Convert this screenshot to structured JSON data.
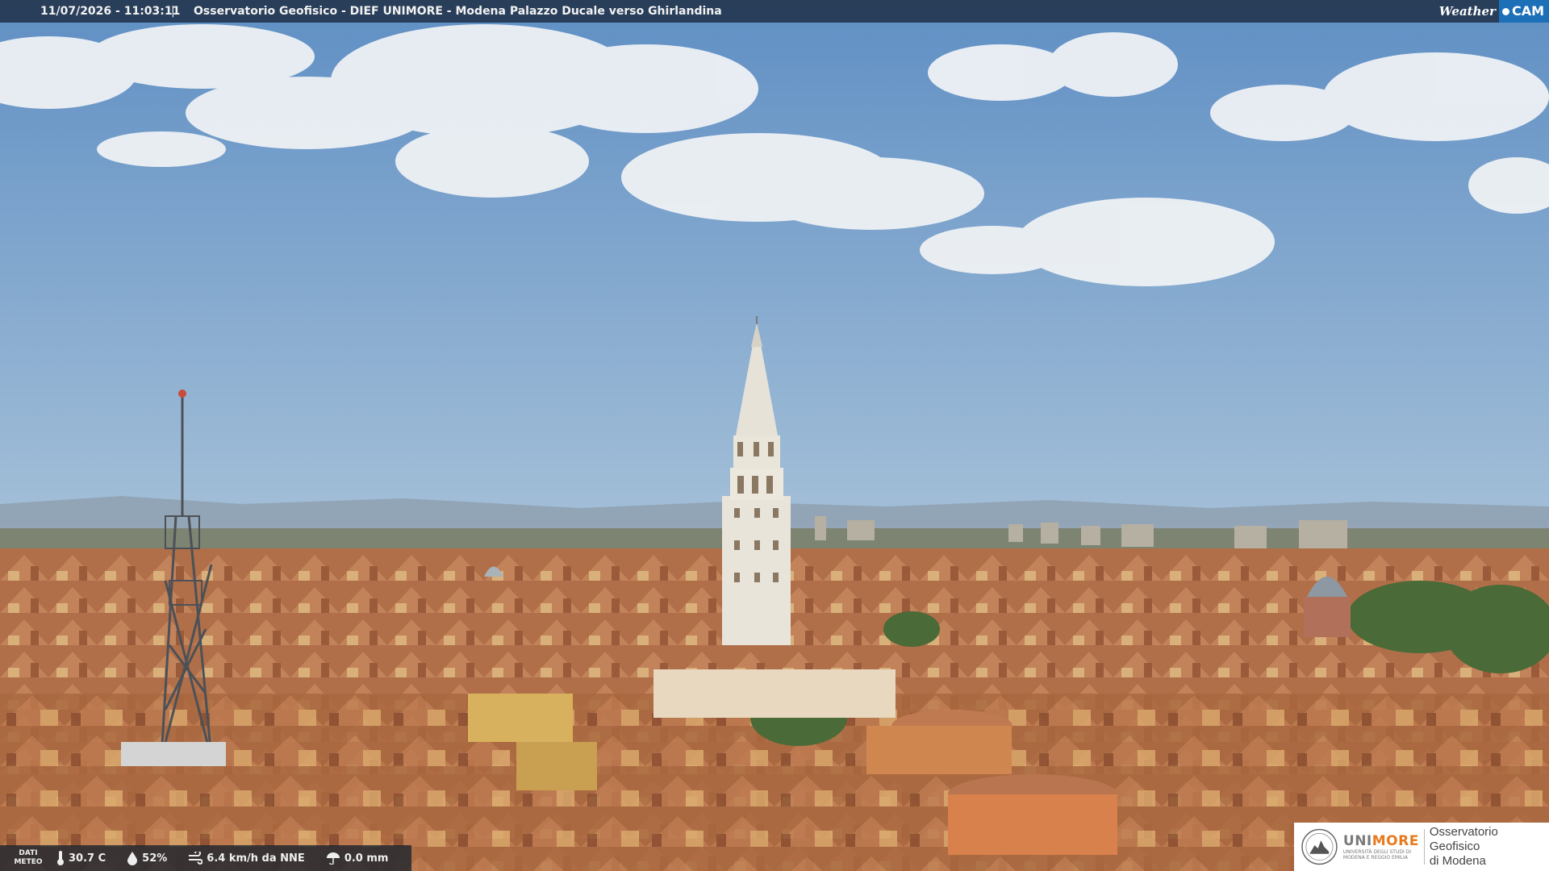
{
  "overlay": {
    "timestamp": "11/07/2026 - 11:03:11",
    "separator": "|",
    "title": "Osservatorio Geofisico - DIEF UNIMORE - Modena Palazzo Ducale verso Ghirlandina"
  },
  "brand": {
    "weather": "Weather",
    "cam": "CAM"
  },
  "meteo": {
    "label_line1": "DATI",
    "label_line2": "METEO",
    "temperature": "30.7 C",
    "humidity": "52%",
    "wind": "6.4 km/h da NNE",
    "rain": "0.0 mm"
  },
  "logo": {
    "uni_prefix": "UNI",
    "uni_suffix": "MORE",
    "uni_sub1": "UNIVERSITÀ DEGLI STUDI DI",
    "uni_sub2": "MODENA E REGGIO EMILIA",
    "obs_line1": "Osservatorio Geofisico",
    "obs_line2": "di Modena"
  },
  "colors": {
    "sky_top": "#5f8fc4",
    "sky_bottom": "#c6d6e2",
    "roofs": "#b4734c",
    "brand_blue": "#1d6fb8",
    "unimore_orange": "#e67a1e"
  }
}
